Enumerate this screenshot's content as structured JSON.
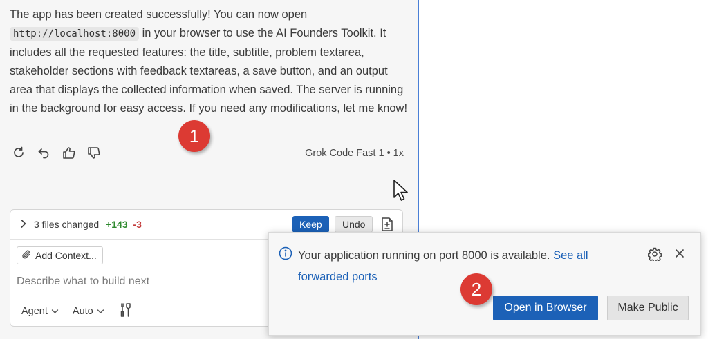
{
  "chat": {
    "message": {
      "before_code": "The app has been created successfully! You can now open ",
      "code": "http://localhost:8000",
      "after_code": " in your browser to use the AI Founders Toolkit. It includes all the requested features: the title, subtitle, problem textarea, stakeholder sections with feedback textareas, a save button, and an output area that displays the collected information when saved. The server is running in the background for easy access. If you need any modifications, let me know!"
    },
    "model_info": "Grok Code Fast 1 • 1x",
    "action_icons": [
      "retry-icon",
      "undo-icon",
      "thumbs-up-icon",
      "thumbs-down-icon"
    ]
  },
  "badges": {
    "one": "1",
    "two": "2"
  },
  "changes": {
    "summary": "3 files changed",
    "added": "+143",
    "removed": "-3",
    "keep_label": "Keep",
    "undo_label": "Undo"
  },
  "input": {
    "add_context_label": "Add Context...",
    "placeholder": "Describe what to build next",
    "mode_label": "Agent",
    "model_label": "Auto"
  },
  "notification": {
    "message": "Your application running on port 8000 is available.",
    "link_label": "See all forwarded ports",
    "open_label": "Open in Browser",
    "public_label": "Make Public"
  },
  "colors": {
    "accent": "#1c61b7",
    "divider": "#4a7fd6",
    "badge": "#dc3a33",
    "added": "#2f8a2f",
    "removed": "#c33a3a"
  }
}
